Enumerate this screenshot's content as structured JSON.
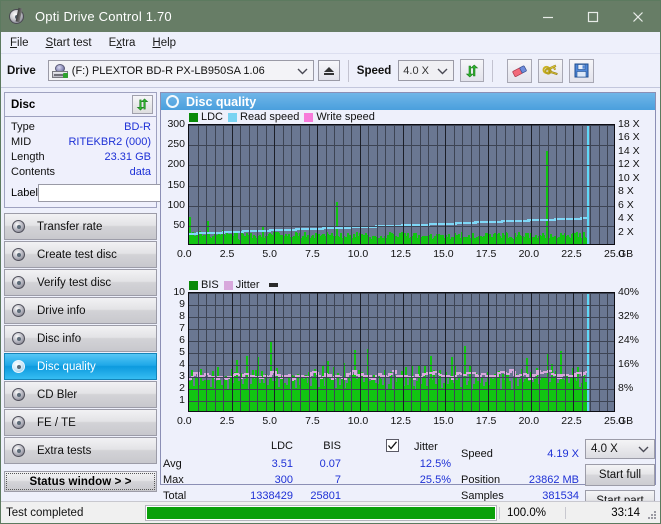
{
  "window": {
    "title": "Opti Drive Control 1.70",
    "app_icon": "disc-pen-icon",
    "minimize": "minimize-icon",
    "maximize": "maximize-icon",
    "close": "close-icon"
  },
  "menu": {
    "items": [
      {
        "label": "File",
        "accel": "F"
      },
      {
        "label": "Start test",
        "accel": "S"
      },
      {
        "label": "Extra",
        "accel": "x"
      },
      {
        "label": "Help",
        "accel": "H"
      }
    ]
  },
  "toolbar": {
    "drive_label": "Drive",
    "drive_value": "(F:)  PLEXTOR BD-R  PX-LB950SA 1.06",
    "eject_label": "eject-icon",
    "speed_label": "Speed",
    "speed_value": "4.0 X",
    "refresh_icon": "refresh-icon",
    "eraser_icon": "eraser-icon",
    "keys_icon": "keys-icon",
    "save_icon": "save-icon"
  },
  "disc_panel": {
    "title": "Disc",
    "refresh_icon": "refresh-icon",
    "rows": [
      {
        "key": "Type",
        "value": "BD-R"
      },
      {
        "key": "MID",
        "value": "RITEKBR2 (000)"
      },
      {
        "key": "Length",
        "value": "23.31 GB"
      },
      {
        "key": "Contents",
        "value": "data"
      }
    ],
    "label_key": "Label",
    "label_value": "",
    "label_placeholder": "",
    "disc_button_icon": "cd-icon"
  },
  "nav": {
    "items": [
      {
        "label": "Transfer rate",
        "icon": "disc-icon",
        "active": false
      },
      {
        "label": "Create test disc",
        "icon": "disc-icon",
        "active": false
      },
      {
        "label": "Verify test disc",
        "icon": "disc-icon",
        "active": false
      },
      {
        "label": "Drive info",
        "icon": "disc-icon",
        "active": false
      },
      {
        "label": "Disc info",
        "icon": "disc-icon",
        "active": false
      },
      {
        "label": "Disc quality",
        "icon": "disc-icon",
        "active": true
      },
      {
        "label": "CD Bler",
        "icon": "disc-icon",
        "active": false
      },
      {
        "label": "FE / TE",
        "icon": "disc-icon",
        "active": false
      },
      {
        "label": "Extra tests",
        "icon": "disc-icon",
        "active": false
      }
    ],
    "status_button": "Status window > >"
  },
  "panel": {
    "title": "Disc quality",
    "icon": "disc-quality-icon"
  },
  "chart_data": [
    {
      "type": "line",
      "name": "ldc-chart",
      "title": "",
      "legend": [
        {
          "label": "LDC",
          "color": "#0a8a0a"
        },
        {
          "label": "Read speed",
          "color": "#79d3f2"
        },
        {
          "label": "Write speed",
          "color": "#f77ada"
        }
      ],
      "legend_position": "top-left",
      "grid": true,
      "xlabel": "GB",
      "x_ticks": [
        "0.0",
        "2.5",
        "5.0",
        "7.5",
        "10.0",
        "12.5",
        "15.0",
        "17.5",
        "20.0",
        "22.5",
        "25.0"
      ],
      "xlim": [
        0,
        25
      ],
      "ylabel": "LDC",
      "y_ticks": [
        "50",
        "100",
        "150",
        "200",
        "250",
        "300"
      ],
      "ylim": [
        0,
        300
      ],
      "y2label": "Speed",
      "y2_ticks": [
        "2 X",
        "4 X",
        "6 X",
        "8 X",
        "10 X",
        "12 X",
        "14 X",
        "16 X",
        "18 X"
      ],
      "y2lim": [
        0,
        18
      ],
      "series": [
        {
          "name": "LDC",
          "color": "#12c412",
          "type": "bar",
          "values": [
            68,
            22,
            15,
            30,
            12,
            18,
            25,
            14,
            20,
            33,
            11,
            16,
            22,
            13,
            19,
            26,
            58,
            14,
            17,
            12,
            21,
            15,
            30,
            12,
            23,
            18,
            11,
            14,
            29,
            35,
            12,
            17,
            22,
            14,
            13,
            19,
            25,
            11,
            16,
            21,
            14,
            18,
            27,
            13,
            11,
            20,
            16,
            24,
            12,
            19,
            15,
            22,
            13,
            17,
            28,
            11,
            14,
            20,
            16,
            12,
            21,
            18,
            23,
            13,
            15,
            44,
            12,
            19,
            17,
            11,
            26,
            14,
            20,
            13,
            22,
            16,
            11,
            18,
            30,
            12,
            15,
            23,
            14,
            19,
            11,
            20,
            17,
            13,
            25,
            12,
            18,
            14,
            21,
            11,
            16,
            22,
            13,
            19,
            27,
            12,
            15,
            20,
            14,
            11,
            18,
            23,
            16,
            12,
            21,
            17,
            11,
            14,
            19,
            13,
            25,
            11,
            16,
            22,
            12,
            18,
            15,
            20,
            11,
            23,
            14,
            17,
            12,
            19,
            11,
            16,
            104,
            21,
            13,
            18,
            12,
            15,
            11,
            20,
            17,
            14,
            11,
            19,
            22,
            12,
            16,
            13,
            18,
            11,
            15,
            21,
            14,
            12,
            17,
            11,
            19,
            13,
            16,
            11,
            22,
            14,
            18,
            12,
            15,
            11,
            20,
            13,
            17,
            11,
            14,
            19,
            12,
            16,
            11,
            21,
            13,
            15,
            11,
            18,
            12,
            14,
            11,
            17,
            13,
            19,
            12,
            15,
            11,
            16,
            14,
            11,
            18,
            12,
            20,
            13,
            15,
            11,
            17,
            12,
            14,
            19,
            11,
            16,
            13,
            18,
            11,
            15,
            12,
            20,
            14,
            11,
            17,
            13,
            16,
            11,
            19,
            12,
            15,
            11,
            18,
            13,
            14,
            11,
            16,
            12,
            19,
            11,
            15,
            13,
            17,
            11,
            14,
            12,
            18,
            11,
            16,
            13,
            15,
            11,
            20,
            12,
            14,
            11,
            17,
            13,
            16,
            11,
            18,
            12,
            15,
            11,
            19,
            13,
            14,
            11,
            16,
            12,
            17,
            11,
            15,
            13,
            18,
            11,
            14,
            12,
            16,
            11,
            19,
            13,
            15,
            11,
            17,
            12,
            14,
            11,
            18,
            13,
            16,
            11,
            15,
            12,
            20,
            11,
            14,
            13,
            17,
            11,
            16,
            12,
            15,
            11,
            18,
            13,
            14,
            11,
            19,
            12,
            16,
            11,
            15,
            13,
            17,
            11,
            14,
            12,
            18,
            11,
            16,
            13,
            15,
            11,
            20,
            12,
            14,
            11,
            17,
            13,
            16,
            230,
            15,
            12,
            18,
            11,
            14,
            13,
            19,
            11,
            16,
            12,
            15,
            11,
            17,
            13,
            14,
            11,
            18,
            12,
            16,
            11,
            15,
            13,
            19,
            11,
            14,
            12,
            17,
            11,
            16,
            13,
            15,
            11,
            18,
            12,
            14
          ]
        },
        {
          "name": "Read speed",
          "color": "#7fd8f7",
          "type": "line",
          "start_x": 0.0,
          "end_x": 23.3,
          "start_value": 2.0,
          "end_value": 4.3
        }
      ],
      "position_marker": {
        "x": 23.3,
        "color": "#5fd8f8"
      }
    },
    {
      "type": "line",
      "name": "bis-jitter-chart",
      "title": "",
      "legend": [
        {
          "label": "BIS",
          "color": "#0a8a0a"
        },
        {
          "label": "Jitter",
          "color": "#d8a8dc"
        }
      ],
      "legend_position": "top-left",
      "grid": true,
      "xlabel": "GB",
      "x_ticks": [
        "0.0",
        "2.5",
        "5.0",
        "7.5",
        "10.0",
        "12.5",
        "15.0",
        "17.5",
        "20.0",
        "22.5",
        "25.0"
      ],
      "xlim": [
        0,
        25
      ],
      "ylabel": "BIS",
      "y_ticks": [
        "1",
        "2",
        "3",
        "4",
        "5",
        "6",
        "7",
        "8",
        "9",
        "10"
      ],
      "ylim": [
        0,
        10
      ],
      "y2label": "Jitter",
      "y2_ticks": [
        "8%",
        "16%",
        "24%",
        "32%",
        "40%"
      ],
      "y2lim": [
        0,
        40
      ],
      "series": [
        {
          "name": "BIS",
          "color": "#12c412",
          "type": "bar",
          "baseline": 1.6,
          "spike_values": [
            2.2,
            1.0,
            3.1,
            1.2,
            2.0,
            1.1,
            2.6,
            1.0,
            3.4,
            1.3,
            2.1,
            1.0,
            2.9,
            1.2,
            2.3,
            1.0,
            3.0,
            1.1,
            2.5,
            1.0,
            2.8,
            1.4,
            2.0,
            1.0,
            3.6,
            1.2,
            2.2,
            1.0,
            2.7,
            1.1,
            3.2,
            1.0,
            2.4,
            1.3,
            2.0,
            1.0,
            2.9,
            1.1,
            3.3,
            1.0,
            2.1,
            1.2,
            2.6,
            1.0,
            3.5,
            1.1,
            2.3,
            1.0,
            2.8,
            1.4,
            4.1,
            1.0,
            2.2,
            1.1,
            3.0,
            1.0,
            2.5,
            1.2,
            2.7,
            1.0,
            3.8,
            1.1,
            2.0,
            1.0,
            2.4,
            1.3,
            3.1,
            1.0,
            2.6,
            1.1,
            2.9,
            1.0,
            4.6,
            1.2,
            2.2,
            1.0,
            3.3,
            1.1,
            2.5,
            1.0,
            2.8,
            1.4,
            2.1,
            1.0,
            3.0,
            1.1,
            5.1,
            1.0,
            2.3,
            1.2,
            2.7,
            1.0,
            3.4,
            1.1,
            2.0,
            1.0,
            2.6,
            1.3,
            3.2,
            1.0,
            2.4,
            1.1
          ]
        },
        {
          "name": "Jitter",
          "color": "#d8a8dc",
          "type": "line",
          "mean_percent": 12.5,
          "range_percent": [
            11.0,
            16.0
          ]
        }
      ],
      "position_marker": {
        "x": 23.3,
        "color": "#5fd8f8"
      }
    }
  ],
  "stats": {
    "columns": [
      "LDC",
      "BIS"
    ],
    "jitter_checkbox_checked": true,
    "jitter_label": "Jitter",
    "rows": [
      {
        "label": "Avg",
        "ldc": "3.51",
        "bis": "0.07",
        "jitter": "12.5%"
      },
      {
        "label": "Max",
        "ldc": "300",
        "bis": "7",
        "jitter": "25.5%"
      },
      {
        "label": "Total",
        "ldc": "1338429",
        "bis": "25801",
        "jitter": ""
      }
    ],
    "speed_label": "Speed",
    "speed_value": "4.19 X",
    "position_label": "Position",
    "position_value": "23862 MB",
    "samples_label": "Samples",
    "samples_value": "381534",
    "speed_select": "4.0 X",
    "start_full": "Start full",
    "start_part": "Start part"
  },
  "footer": {
    "status": "Test completed",
    "progress_percent": 100.0,
    "progress_text": "100.0%",
    "elapsed": "33:14"
  },
  "colors": {
    "accent": "#1e31d6",
    "title_bar": "#677d66",
    "panel_header": "#4a9fdd",
    "plot_bg": "#6a7792",
    "green": "#12c412",
    "cyan": "#7fd8f7",
    "pink": "#f77ada",
    "jitter": "#d8a8dc",
    "progress": "#09a009"
  }
}
